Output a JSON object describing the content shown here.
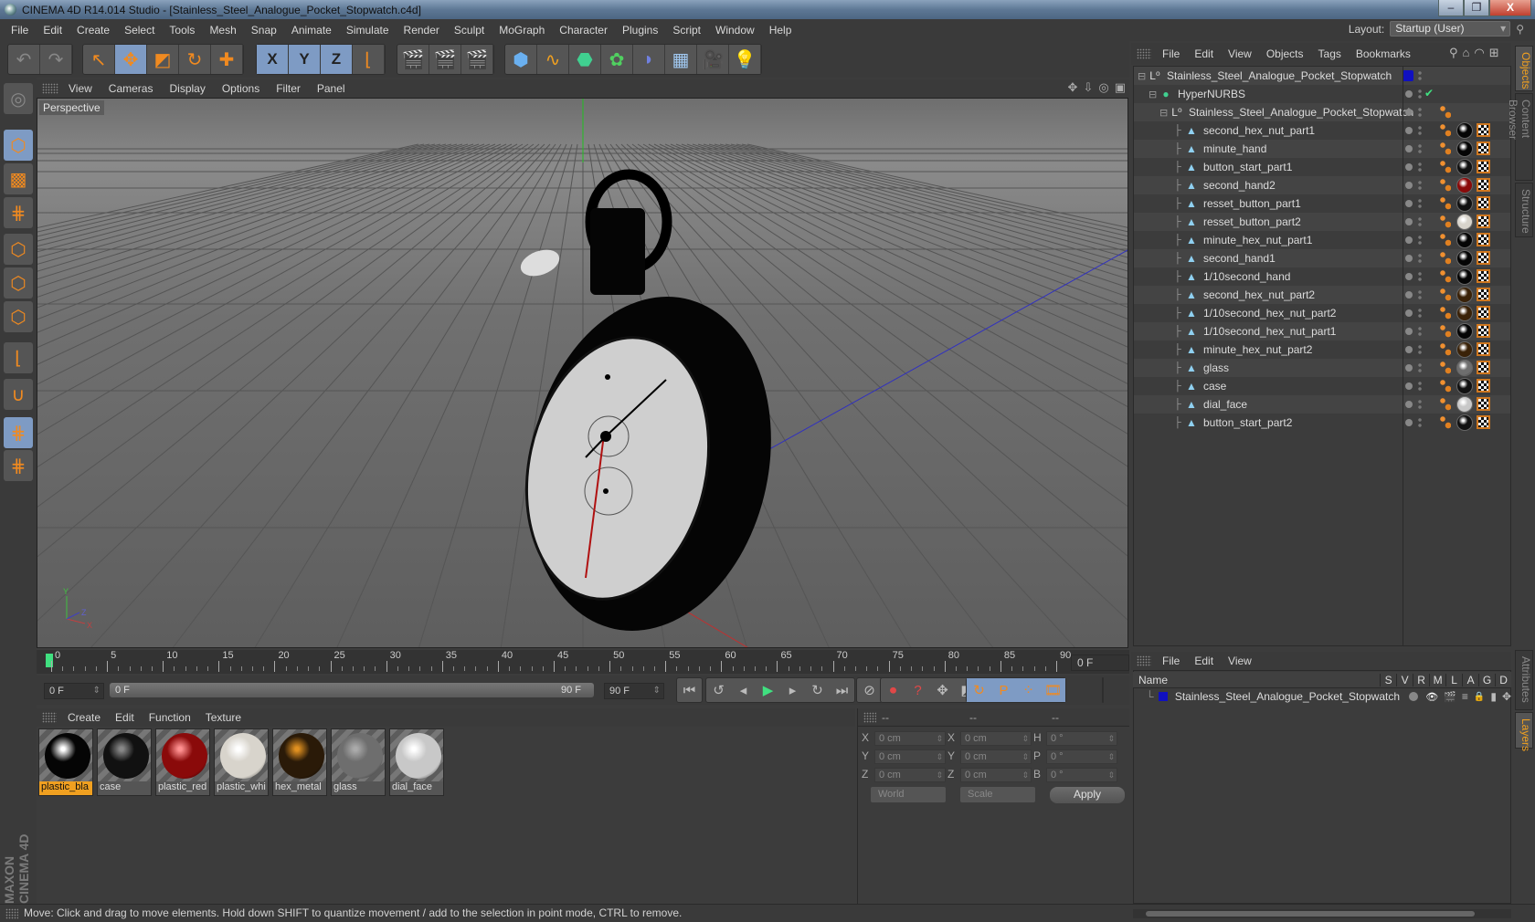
{
  "window": {
    "title": "CINEMA 4D R14.014 Studio - [Stainless_Steel_Analogue_Pocket_Stopwatch.c4d]",
    "buttons": {
      "minimize": "–",
      "restore": "❐",
      "close": "X"
    }
  },
  "menubar": [
    "File",
    "Edit",
    "Create",
    "Select",
    "Tools",
    "Mesh",
    "Snap",
    "Animate",
    "Simulate",
    "Render",
    "Sculpt",
    "MoGraph",
    "Character",
    "Plugins",
    "Script",
    "Window",
    "Help"
  ],
  "layout": {
    "label": "Layout:",
    "value": "Startup (User)"
  },
  "toolbar": {
    "groups": [
      {
        "name": "history",
        "items": [
          {
            "icon": "undo-icon",
            "glyph": "↶"
          },
          {
            "icon": "redo-icon",
            "glyph": "↷"
          }
        ]
      },
      {
        "name": "tools",
        "items": [
          {
            "icon": "live-selection-icon",
            "glyph": "↖"
          },
          {
            "icon": "move-icon",
            "glyph": "✥",
            "active": true
          },
          {
            "icon": "scale-icon",
            "glyph": "◩"
          },
          {
            "icon": "rotate-icon",
            "glyph": "↻"
          },
          {
            "icon": "recent-tool-icon",
            "glyph": "✚"
          }
        ]
      },
      {
        "name": "axes",
        "items": [
          {
            "icon": "x-axis-icon",
            "glyph": "X",
            "active": true
          },
          {
            "icon": "y-axis-icon",
            "glyph": "Y",
            "active": true
          },
          {
            "icon": "z-axis-icon",
            "glyph": "Z",
            "active": true
          },
          {
            "icon": "coordinate-system-icon",
            "glyph": "⌊"
          }
        ]
      },
      {
        "name": "render",
        "items": [
          {
            "icon": "render-view-icon",
            "glyph": "🎬"
          },
          {
            "icon": "render-picture-viewer-icon",
            "glyph": "🎬"
          },
          {
            "icon": "render-settings-icon",
            "glyph": "🎬"
          }
        ]
      },
      {
        "name": "objects",
        "items": [
          {
            "icon": "cube-icon",
            "glyph": "⬢"
          },
          {
            "icon": "spline-icon",
            "glyph": "∿"
          },
          {
            "icon": "nurbs-icon",
            "glyph": "⬣"
          },
          {
            "icon": "array-icon",
            "glyph": "✿"
          },
          {
            "icon": "deformer-icon",
            "glyph": "◗"
          },
          {
            "icon": "floor-icon",
            "glyph": "▦"
          },
          {
            "icon": "camera-icon",
            "glyph": "🎥"
          },
          {
            "icon": "light-icon",
            "glyph": "💡"
          }
        ]
      }
    ]
  },
  "left_palette": [
    {
      "icon": "make-editable-icon",
      "glyph": "◎"
    },
    {
      "icon": "model-mode-icon",
      "glyph": "⬡",
      "active": true
    },
    {
      "icon": "texture-mode-icon",
      "glyph": "▩"
    },
    {
      "icon": "workplane-mode-icon",
      "glyph": "⋕"
    },
    {
      "icon": "points-mode-icon",
      "glyph": "⬡"
    },
    {
      "icon": "edges-mode-icon",
      "glyph": "⬡"
    },
    {
      "icon": "polygons-mode-icon",
      "glyph": "⬡"
    },
    {
      "icon": "axis-mode-icon",
      "glyph": "⌊"
    },
    {
      "icon": "snapping-icon",
      "glyph": "∪"
    },
    {
      "icon": "locked-workplane-icon",
      "glyph": "⋕",
      "active": true
    },
    {
      "icon": "planar-workplane-icon",
      "glyph": "⋕"
    }
  ],
  "branding": "MAXON CINEMA 4D",
  "viewport": {
    "menu": [
      "View",
      "Cameras",
      "Display",
      "Options",
      "Filter",
      "Panel"
    ],
    "label": "Perspective",
    "nav_icons": [
      "move-view-icon",
      "dolly-view-icon",
      "rotate-view-icon",
      "toggle-layout-icon"
    ],
    "axis_labels": {
      "x": "X",
      "y": "Y",
      "z": "Z"
    }
  },
  "timeline": {
    "ticks": [
      "0",
      "5",
      "10",
      "15",
      "20",
      "25",
      "30",
      "35",
      "40",
      "45",
      "50",
      "55",
      "60",
      "65",
      "70",
      "75",
      "80",
      "85",
      "90"
    ],
    "current_frame": "0 F",
    "start_field": "0 F",
    "range_start": "0 F",
    "range_end": "90 F",
    "end_field": "90 F"
  },
  "transport": {
    "buttons": [
      {
        "icon": "go-to-start-icon",
        "glyph": "⏮"
      },
      {
        "icon": "previous-key-icon",
        "glyph": "↺"
      },
      {
        "icon": "previous-frame-icon",
        "glyph": "◂"
      },
      {
        "icon": "play-icon",
        "glyph": "▶"
      },
      {
        "icon": "next-frame-icon",
        "glyph": "▸"
      },
      {
        "icon": "next-key-icon",
        "glyph": "↻"
      },
      {
        "icon": "go-to-end-icon",
        "glyph": "⏭"
      },
      {
        "icon": "autokey-off-icon",
        "glyph": "⊘"
      },
      {
        "icon": "record-icon",
        "glyph": "⏺"
      },
      {
        "icon": "autokeying-icon",
        "glyph": "?"
      },
      {
        "icon": "key-position-icon",
        "glyph": "✥"
      },
      {
        "icon": "key-scale-icon",
        "glyph": "◩"
      },
      {
        "icon": "key-rotation-icon",
        "glyph": "↻"
      },
      {
        "icon": "key-parameter-icon",
        "glyph": "P"
      },
      {
        "icon": "key-pla-icon",
        "glyph": "⁘"
      },
      {
        "icon": "timeline-window-icon",
        "glyph": "🎞"
      }
    ]
  },
  "material_manager": {
    "menu": [
      "Create",
      "Edit",
      "Function",
      "Texture"
    ],
    "materials": [
      {
        "name": "plastic_bla",
        "color": "#050505",
        "highlight": "#ffffff",
        "selected": true
      },
      {
        "name": "case",
        "color": "#111111",
        "highlight": "#888888"
      },
      {
        "name": "plastic_red",
        "color": "#8a0a0a",
        "highlight": "#ff9090"
      },
      {
        "name": "plastic_whi",
        "color": "#d8d4cc",
        "highlight": "#ffffff"
      },
      {
        "name": "hex_metal",
        "color": "#2a1a08",
        "highlight": "#e09020"
      },
      {
        "name": "glass",
        "color": "#6e6e6e",
        "highlight": "#aaaaaa"
      },
      {
        "name": "dial_face",
        "color": "#c8c8c8",
        "highlight": "#ffffff"
      }
    ]
  },
  "coordinate_manager": {
    "headers": [
      "--",
      "--",
      "--"
    ],
    "rows": [
      {
        "l1": "X",
        "v1": "0 cm",
        "l2": "X",
        "v2": "0 cm",
        "l3": "H",
        "v3": "0 °"
      },
      {
        "l1": "Y",
        "v1": "0 cm",
        "l2": "Y",
        "v2": "0 cm",
        "l3": "P",
        "v3": "0 °"
      },
      {
        "l1": "Z",
        "v1": "0 cm",
        "l2": "Z",
        "v2": "0 cm",
        "l3": "B",
        "v3": "0 °"
      }
    ],
    "space": "World",
    "mode": "Scale",
    "apply": "Apply"
  },
  "object_manager": {
    "menu": [
      "File",
      "Edit",
      "View",
      "Objects",
      "Tags",
      "Bookmarks"
    ],
    "toolbar_icons": [
      "search-icon",
      "home-icon",
      "eye-icon",
      "new-window-icon"
    ],
    "objects": [
      {
        "name": "Stainless_Steel_Analogue_Pocket_Stopwatch",
        "level": 0,
        "type": "null",
        "layer_color": "#1010c0"
      },
      {
        "name": "HyperNURBS",
        "level": 1,
        "type": "hypernurbs",
        "enabled": true
      },
      {
        "name": "Stainless_Steel_Analogue_Pocket_Stopwatch",
        "level": 2,
        "type": "null",
        "tags": [
          "phong"
        ]
      },
      {
        "name": "second_hex_nut_part1",
        "level": 3,
        "type": "polygon",
        "material": "#050505"
      },
      {
        "name": "minute_hand",
        "level": 3,
        "type": "polygon",
        "material": "#050505"
      },
      {
        "name": "button_start_part1",
        "level": 3,
        "type": "polygon",
        "material": "#111111"
      },
      {
        "name": "second_hand2",
        "level": 3,
        "type": "polygon",
        "material": "#8a0a0a"
      },
      {
        "name": "resset_button_part1",
        "level": 3,
        "type": "polygon",
        "material": "#111111"
      },
      {
        "name": "resset_button_part2",
        "level": 3,
        "type": "polygon",
        "material": "#d8d4cc"
      },
      {
        "name": "minute_hex_nut_part1",
        "level": 3,
        "type": "polygon",
        "material": "#050505"
      },
      {
        "name": "second_hand1",
        "level": 3,
        "type": "polygon",
        "material": "#050505"
      },
      {
        "name": "1/10second_hand",
        "level": 3,
        "type": "polygon",
        "material": "#050505"
      },
      {
        "name": "second_hex_nut_part2",
        "level": 3,
        "type": "polygon",
        "material": "#3a2208"
      },
      {
        "name": "1/10second_hex_nut_part2",
        "level": 3,
        "type": "polygon",
        "material": "#3a2208"
      },
      {
        "name": "1/10second_hex_nut_part1",
        "level": 3,
        "type": "polygon",
        "material": "#050505"
      },
      {
        "name": "minute_hex_nut_part2",
        "level": 3,
        "type": "polygon",
        "material": "#3a2208"
      },
      {
        "name": "glass",
        "level": 3,
        "type": "polygon",
        "material": "#6e6e6e"
      },
      {
        "name": "case",
        "level": 3,
        "type": "polygon",
        "material": "#111111"
      },
      {
        "name": "dial_face",
        "level": 3,
        "type": "polygon",
        "material": "#c8c8c8"
      },
      {
        "name": "button_start_part2",
        "level": 3,
        "type": "polygon",
        "material": "#111111"
      }
    ]
  },
  "side_tabs_top": [
    {
      "label": "Objects",
      "active": true
    },
    {
      "label": "Content Browser"
    },
    {
      "label": "Structure"
    }
  ],
  "side_tabs_bottom": [
    {
      "label": "Attributes"
    },
    {
      "label": "Layers",
      "active": true
    }
  ],
  "layer_manager": {
    "menu": [
      "File",
      "Edit",
      "View"
    ],
    "columns": [
      "Name",
      "S",
      "V",
      "R",
      "M",
      "L",
      "A",
      "G",
      "D"
    ],
    "layers": [
      {
        "name": "Stainless_Steel_Analogue_Pocket_Stopwatch",
        "color": "#1010c0"
      }
    ]
  },
  "status_bar": "Move: Click and drag to move elements. Hold down SHIFT to quantize movement / add to the selection in point mode, CTRL to remove.",
  "colors": {
    "accent": "#f08a20",
    "active_button": "#7e9bc4",
    "selected_material": "#f0a020"
  }
}
